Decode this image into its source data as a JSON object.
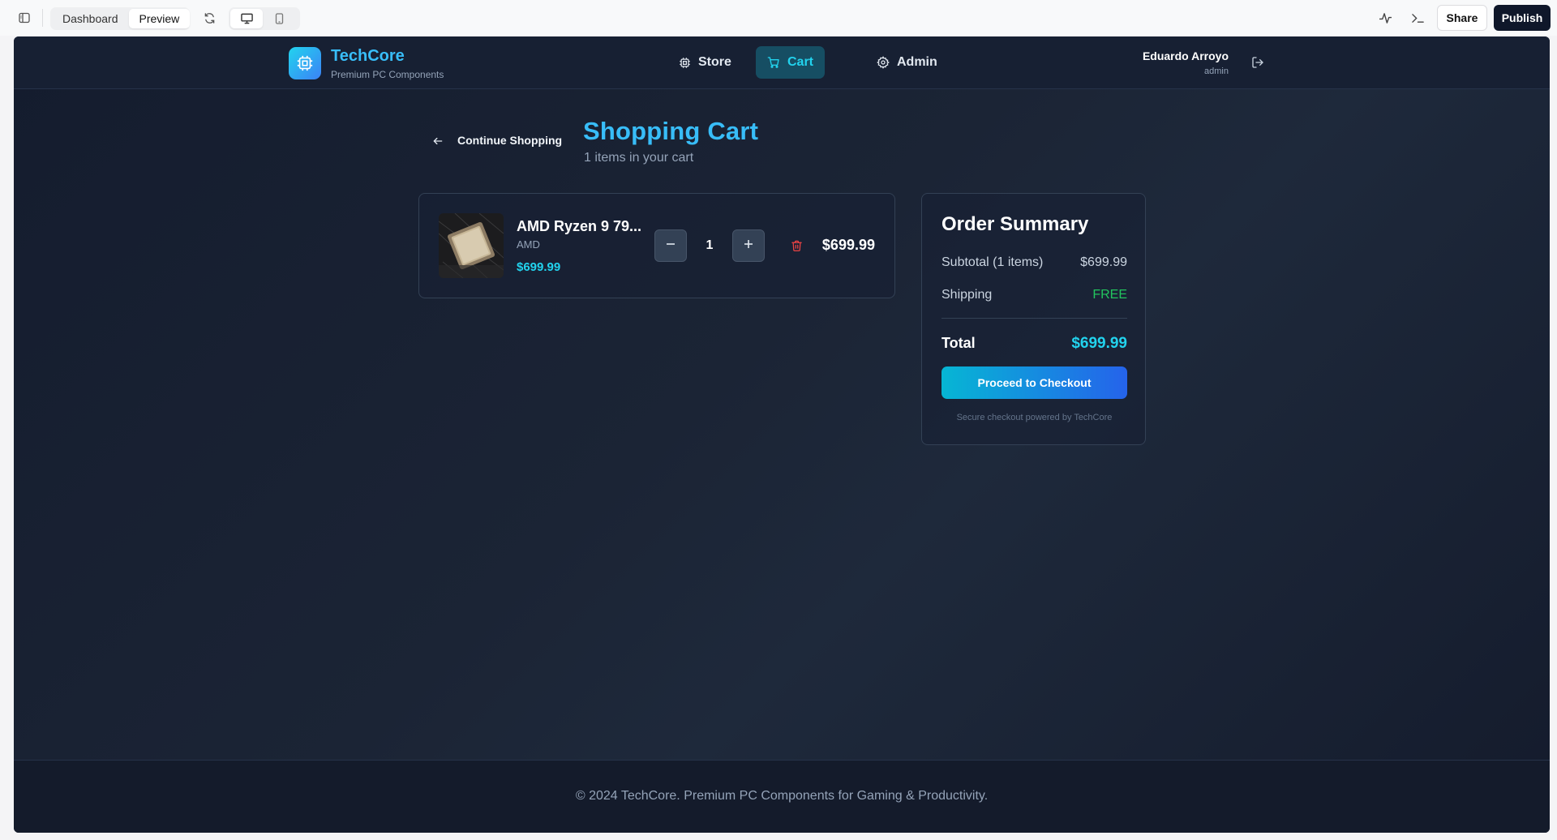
{
  "toolbar": {
    "tabs": [
      {
        "label": "Dashboard"
      },
      {
        "label": "Preview"
      }
    ],
    "share_label": "Share",
    "publish_label": "Publish"
  },
  "app": {
    "brand": "TechCore",
    "tagline": "Premium PC Components",
    "nav": [
      {
        "label": "Store"
      },
      {
        "label": "Cart"
      },
      {
        "label": "Admin"
      }
    ],
    "user": {
      "name": "Eduardo Arroyo",
      "role": "admin"
    }
  },
  "cart": {
    "back_label": "Continue Shopping",
    "title": "Shopping Cart",
    "subtitle": "1 items in your cart",
    "items": [
      {
        "name": "AMD Ryzen 9 79...",
        "brand": "AMD",
        "price": "$699.99",
        "quantity": "1",
        "line_total": "$699.99"
      }
    ]
  },
  "summary": {
    "title": "Order Summary",
    "subtotal_label": "Subtotal (1 items)",
    "subtotal_value": "$699.99",
    "shipping_label": "Shipping",
    "shipping_value": "FREE",
    "total_label": "Total",
    "total_value": "$699.99",
    "checkout_label": "Proceed to Checkout",
    "secure_note": "Secure checkout powered by TechCore"
  },
  "footer": {
    "text": "© 2024 TechCore. Premium PC Components for Gaming & Productivity."
  },
  "colors": {
    "accent": "#22d3ee",
    "title": "#38bdf8",
    "free": "#22c55e",
    "danger": "#ef4444",
    "publish_bg": "#0f172a"
  }
}
